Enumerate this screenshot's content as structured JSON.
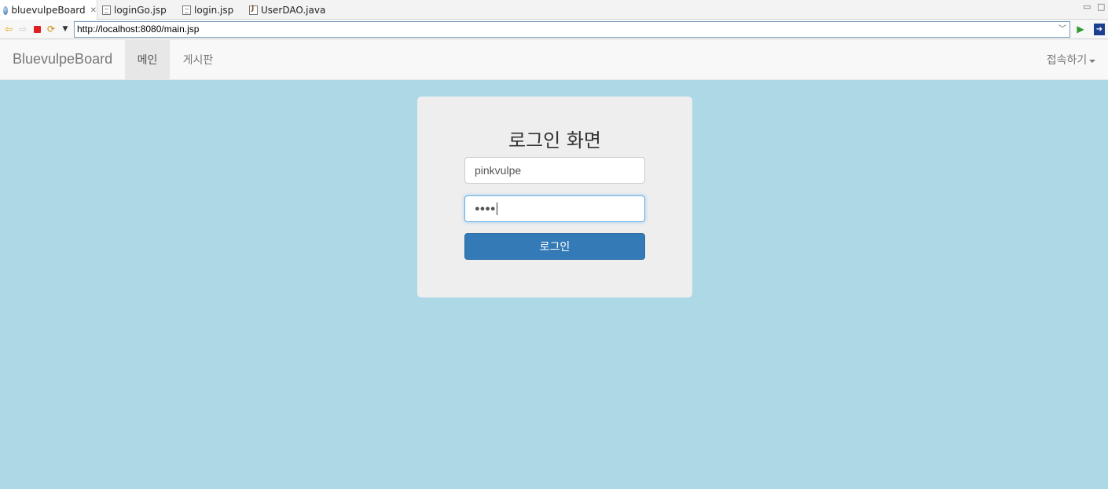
{
  "editor_tabs": [
    {
      "label": "bluevulpeBoard",
      "icon": "globe-icon",
      "active": true,
      "closable": true
    },
    {
      "label": "loginGo.jsp",
      "icon": "jsp-file-icon"
    },
    {
      "label": "login.jsp",
      "icon": "jsp-file-icon"
    },
    {
      "label": "UserDAO.java",
      "icon": "java-file-icon"
    }
  ],
  "browser": {
    "url": "http://localhost:8080/main.jsp"
  },
  "navbar": {
    "brand": "BluevulpeBoard",
    "items": [
      {
        "label": "메인",
        "active": true
      },
      {
        "label": "게시판",
        "active": false
      }
    ],
    "dropdown_label": "접속하기"
  },
  "login": {
    "title": "로그인 화면",
    "username_value": "pinkvulpe",
    "password_masked": "●●●●",
    "submit_label": "로그인"
  },
  "colors": {
    "page_background": "#add8e6",
    "primary_button": "#337ab7",
    "jumbotron": "#eeeeee"
  }
}
